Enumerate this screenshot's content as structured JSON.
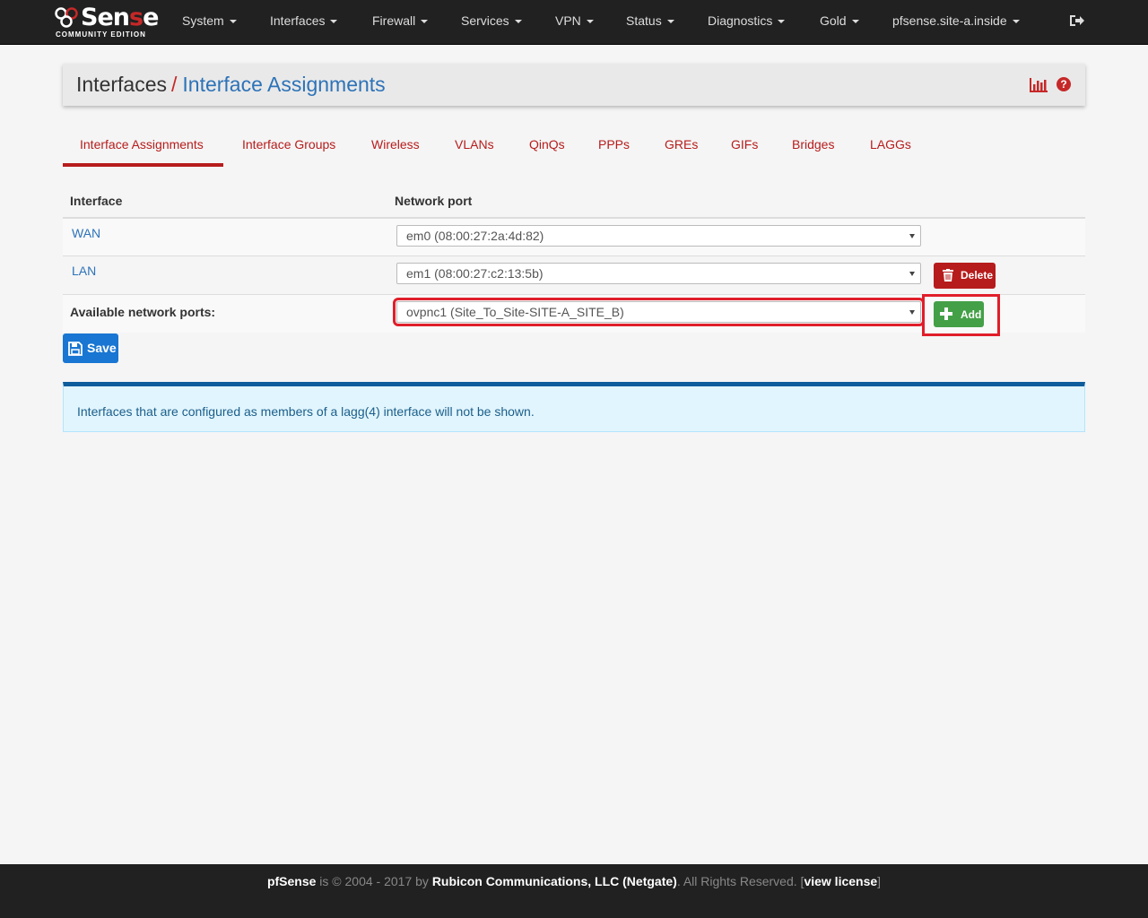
{
  "brand": {
    "name_pre": "Sen",
    "name_red": "s",
    "name_post": "e",
    "edition": "COMMUNITY EDITION"
  },
  "nav": {
    "items": [
      {
        "label": "System"
      },
      {
        "label": "Interfaces"
      },
      {
        "label": "Firewall"
      },
      {
        "label": "Services"
      },
      {
        "label": "VPN"
      },
      {
        "label": "Status"
      },
      {
        "label": "Diagnostics"
      },
      {
        "label": "Gold"
      },
      {
        "label": "pfsense.site-a.inside"
      }
    ],
    "logout_icon": "sign-out-icon"
  },
  "breadcrumb": {
    "parent": "Interfaces",
    "separator": "/",
    "current": "Interface Assignments"
  },
  "header_icons": {
    "chart": "bar-chart-icon",
    "help": "question-circle-icon",
    "help_glyph": "?"
  },
  "tabs": [
    {
      "label": "Interface Assignments",
      "active": true
    },
    {
      "label": "Interface Groups"
    },
    {
      "label": "Wireless"
    },
    {
      "label": "VLANs"
    },
    {
      "label": "QinQs"
    },
    {
      "label": "PPPs"
    },
    {
      "label": "GREs"
    },
    {
      "label": "GIFs"
    },
    {
      "label": "Bridges"
    },
    {
      "label": "LAGGs"
    }
  ],
  "table": {
    "headers": {
      "interface": "Interface",
      "port": "Network port"
    },
    "rows": [
      {
        "interface": "WAN",
        "port": "em0 (08:00:27:2a:4d:82)"
      },
      {
        "interface": "LAN",
        "port": "em1 (08:00:27:c2:13:5b)",
        "action": "Delete"
      }
    ],
    "available": {
      "label": "Available network ports:",
      "port": "ovpnc1 (Site_To_Site-SITE-A_SITE_B)",
      "action": "Add"
    }
  },
  "save_label": "Save",
  "info": "Interfaces that are configured as members of a lagg(4) interface will not be shown.",
  "footer": {
    "product": "pfSense",
    "mid": " is © 2004 - 2017 by ",
    "company": "Rubicon Communications, LLC (Netgate)",
    "rights": ". All Rights Reserved. [",
    "license": "view license",
    "close": "]"
  },
  "colors": {
    "nav_bg": "#212121",
    "accent_red": "#b71c1c",
    "link_blue": "#2d73b8",
    "add_green": "#43a047",
    "save_blue": "#1976d2",
    "highlight": "#e01e2a"
  }
}
